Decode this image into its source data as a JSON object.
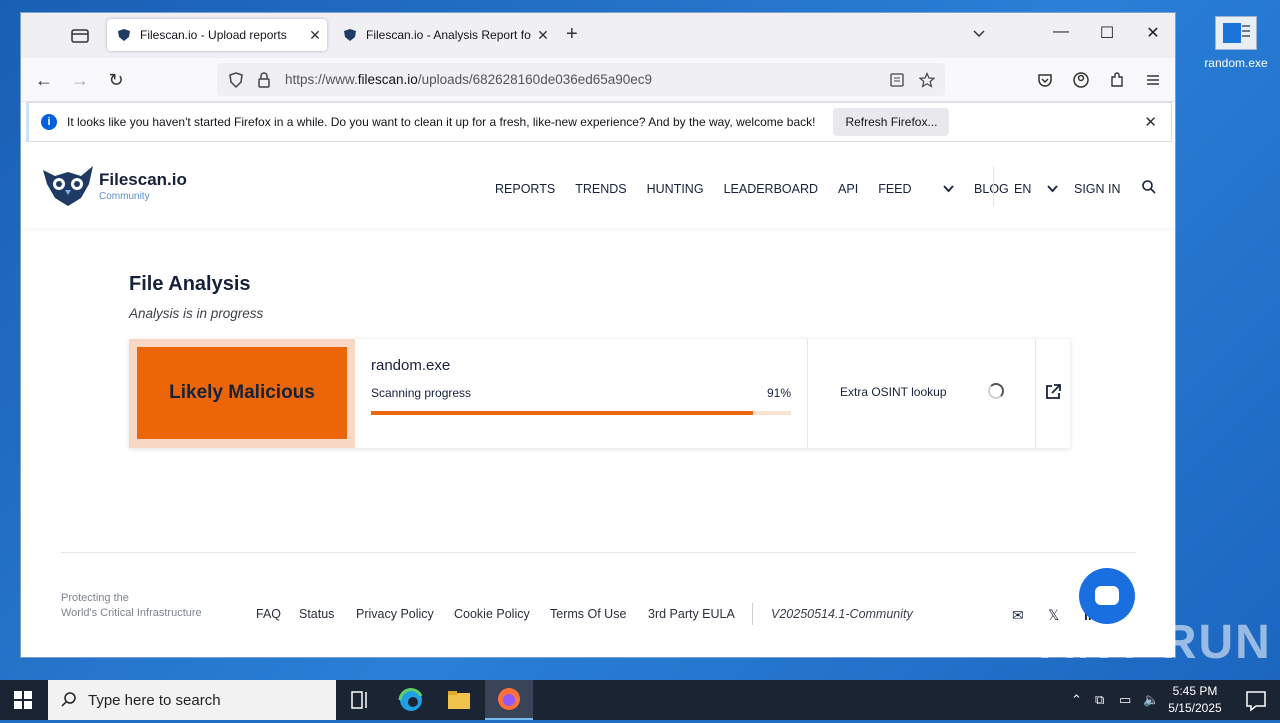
{
  "desktop": {
    "icon_label": "random.exe"
  },
  "browser": {
    "tabs": [
      {
        "title": "Filescan.io - Upload reports",
        "active": true
      },
      {
        "title": "Filescan.io - Analysis Report for",
        "active": false
      }
    ],
    "url_prefix": "https://www.",
    "url_domain": "filescan.io",
    "url_path": "/uploads/682628160de036ed65a90ec9",
    "infobar": {
      "message": "It looks like you haven't started Firefox in a while. Do you want to clean it up for a fresh, like-new experience? And by the way, welcome back!",
      "button": "Refresh Firefox..."
    }
  },
  "site": {
    "brand_name": "Filescan.io",
    "brand_sub": "Community",
    "nav": [
      "REPORTS",
      "TRENDS",
      "HUNTING",
      "LEADERBOARD",
      "API",
      "FEED",
      "BLOG"
    ],
    "lang": "EN",
    "signin": "SIGN IN"
  },
  "analysis": {
    "title": "File Analysis",
    "subtitle": "Analysis is in progress",
    "verdict": "Likely Malicious",
    "filename": "random.exe",
    "progress_label": "Scanning progress",
    "progress_pct_text": "91%",
    "progress_fraction": 0.91,
    "osint_label": "Extra OSINT lookup"
  },
  "footer": {
    "tagline_line1": "Protecting the",
    "tagline_line2": "World's Critical Infrastructure",
    "links": [
      "FAQ",
      "Status",
      "Privacy Policy",
      "Cookie Policy",
      "Terms Of Use",
      "3rd Party EULA"
    ],
    "version": "V20250514.1-Community"
  },
  "watermark": "ANY RUN",
  "taskbar": {
    "search_placeholder": "Type here to search",
    "time": "5:45 PM",
    "date": "5/15/2025"
  },
  "colors": {
    "accent_orange": "#ec6608",
    "navy": "#16213a",
    "firefox_blue": "#0060df"
  }
}
